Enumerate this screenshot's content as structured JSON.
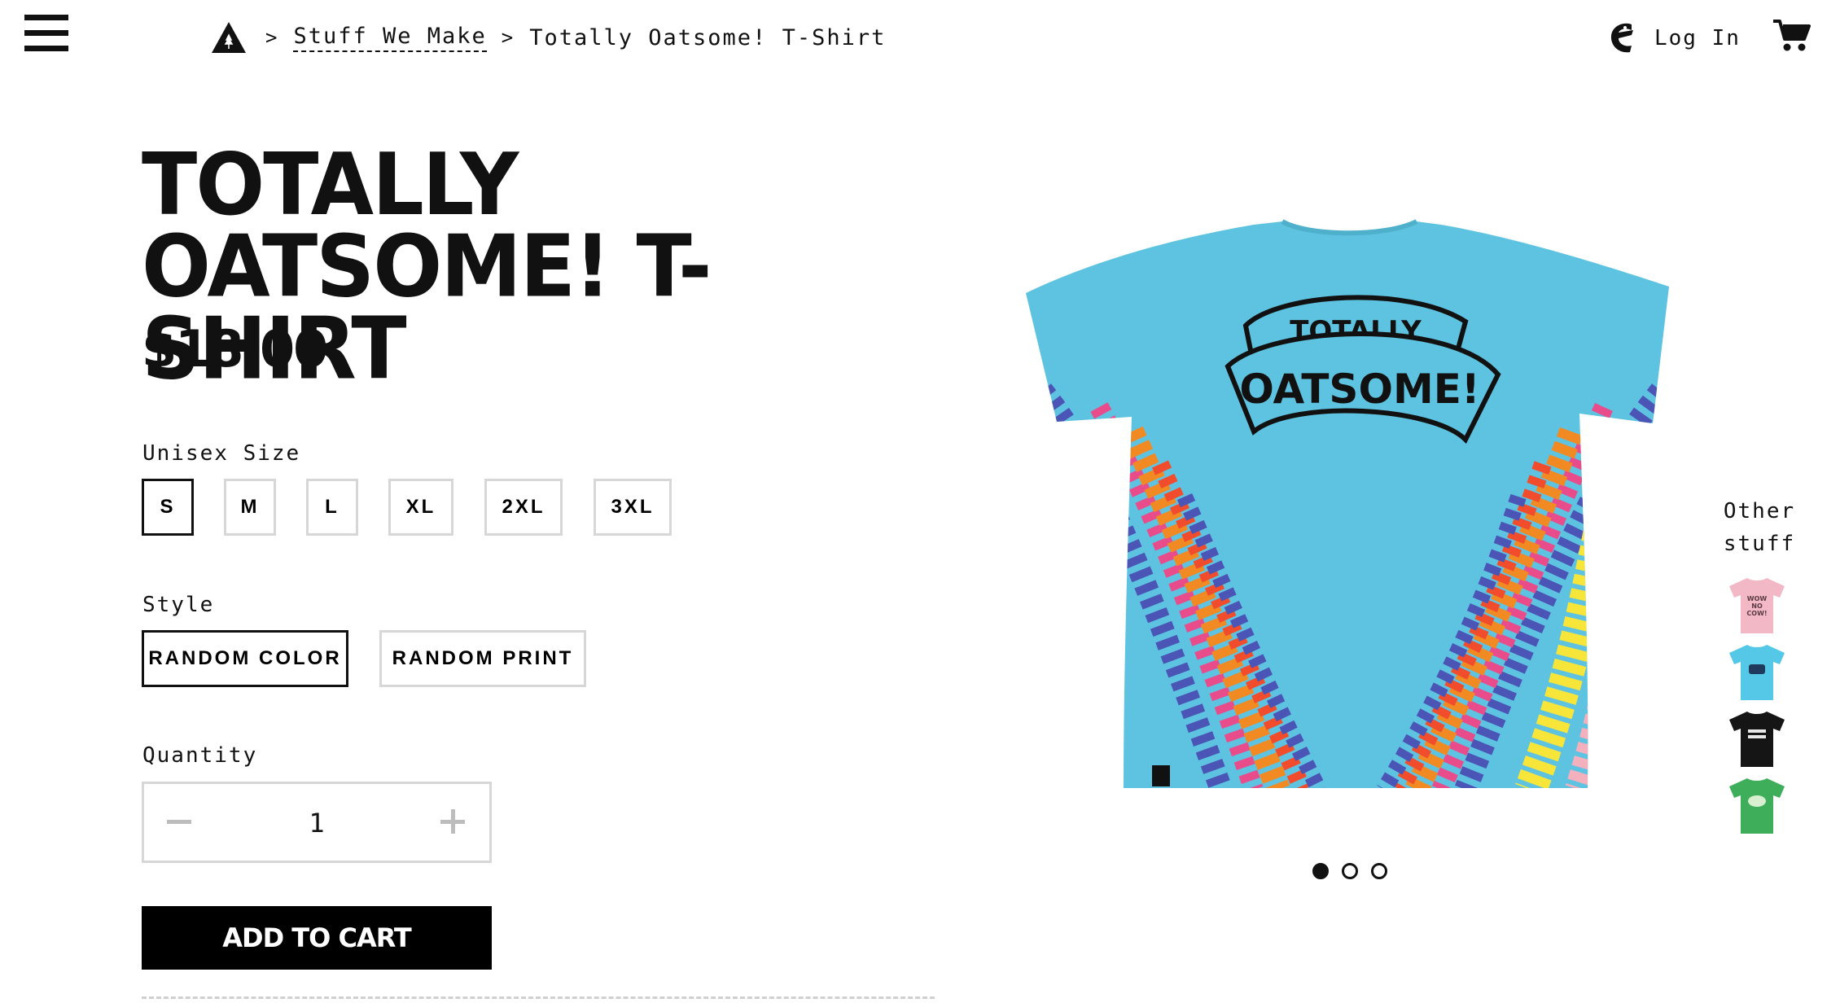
{
  "header": {
    "breadcrumb": {
      "separator": ">",
      "link_label": "Stuff We Make",
      "current_label": "Totally Oatsome! T-Shirt"
    },
    "login_label": "Log In"
  },
  "product": {
    "title": "Totally Oatsome! T-Shirt",
    "price": "$18.00",
    "size_label": "Unisex Size",
    "sizes": [
      "S",
      "M",
      "L",
      "XL",
      "2XL",
      "3XL"
    ],
    "selected_size": "S",
    "style_label": "Style",
    "styles": [
      "Random Color",
      "Random Print"
    ],
    "selected_style": "Random Color",
    "quantity_label": "Quantity",
    "quantity": "1",
    "add_to_cart_label": "Add to Cart",
    "shirt_text_top": "TOTALLY",
    "shirt_text_bottom": "OATSOME!"
  },
  "gallery": {
    "slide_count": 3,
    "active_slide": 1
  },
  "other_stuff": {
    "title": "Other stuff",
    "thumbnails": [
      {
        "name": "pink-shirt-thumbnail",
        "color": "#f2b8c6",
        "print": "WOW NO COW!"
      },
      {
        "name": "blue-shirt-thumbnail",
        "color": "#54c8e6",
        "print": ""
      },
      {
        "name": "black-shirt-thumbnail",
        "color": "#151515",
        "print": ""
      },
      {
        "name": "green-shirt-thumbnail",
        "color": "#3fae5a",
        "print": ""
      }
    ]
  },
  "colors": {
    "text": "#111111",
    "button_bg": "#000000",
    "border_inactive": "#d7d7d7",
    "shirt_blue": "#5ec3e0"
  },
  "icons": {
    "menu": "hamburger-icon",
    "home": "oatly-logo-icon",
    "login": "chomping-face-icon",
    "cart": "cart-icon"
  }
}
